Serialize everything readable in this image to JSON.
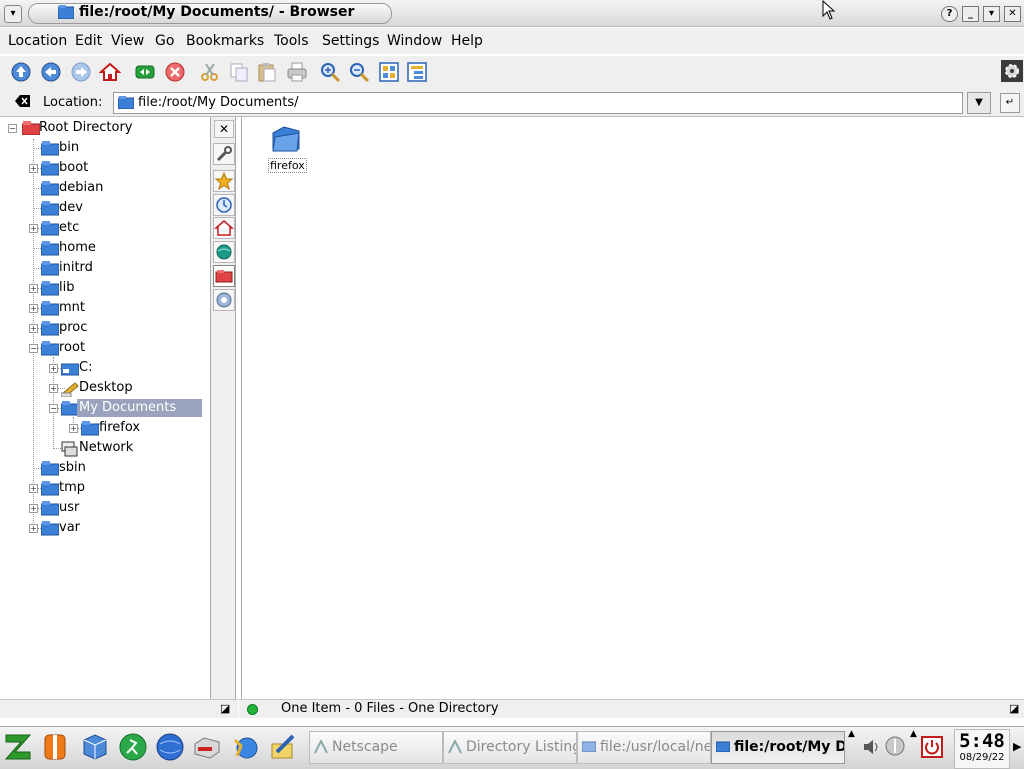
{
  "window": {
    "title": "file:/root/My Documents/ - Browser",
    "controls": [
      "?",
      "_",
      "▾",
      "✕"
    ]
  },
  "menubar": {
    "items": [
      "Location",
      "Edit",
      "View",
      "Go",
      "Bookmarks",
      "Tools",
      "Settings",
      "Window",
      "Help"
    ]
  },
  "toolbar": {
    "icons": [
      "home-icon",
      "back-icon",
      "forward-icon",
      "home-page-icon",
      "reload-icon",
      "stop-icon",
      "cut-icon",
      "copy-icon",
      "paste-icon",
      "print-icon",
      "zoom-in-icon",
      "zoom-out-icon",
      "icon-view-icon",
      "tree-view-icon"
    ]
  },
  "locationbar": {
    "label": "Location:",
    "value": "file:/root/My Documents/"
  },
  "tree": {
    "root_label": "Root Directory",
    "items": [
      {
        "label": "bin"
      },
      {
        "label": "boot"
      },
      {
        "label": "debian"
      },
      {
        "label": "dev"
      },
      {
        "label": "etc"
      },
      {
        "label": "home"
      },
      {
        "label": "initrd"
      },
      {
        "label": "lib"
      },
      {
        "label": "mnt"
      },
      {
        "label": "proc"
      },
      {
        "label": "root"
      },
      {
        "label": "C:"
      },
      {
        "label": "Desktop"
      },
      {
        "label": "My Documents"
      },
      {
        "label": "firefox"
      },
      {
        "label": "Network"
      },
      {
        "label": "sbin"
      },
      {
        "label": "tmp"
      },
      {
        "label": "usr"
      },
      {
        "label": "var"
      }
    ]
  },
  "content": {
    "items": [
      {
        "label": "firefox"
      }
    ]
  },
  "status": {
    "text": "One Item - 0 Files - One Directory"
  },
  "taskbar": {
    "tasks": [
      {
        "label": "Netscape"
      },
      {
        "label": "Directory Listing"
      },
      {
        "label": "file:/usr/local/net"
      },
      {
        "label": "file:/root/My Do"
      }
    ],
    "clock_time": "5:48",
    "clock_date": "08/29/22"
  },
  "colors": {
    "selection": "#9aa3bd",
    "folder_blue": "#3c7fd6",
    "chrome": "#efefef"
  }
}
